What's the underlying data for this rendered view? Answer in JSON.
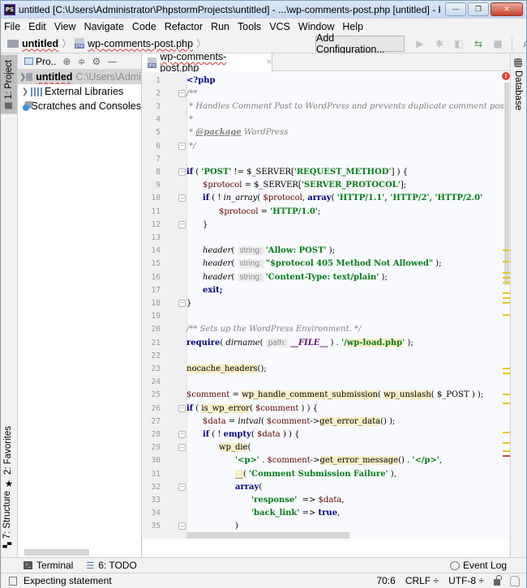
{
  "window": {
    "title": "untitled [C:\\Users\\Administrator\\PhpstormProjects\\untitled] - ...\\wp-comments-post.php [untitled] - PhpSto...",
    "app_logo": "PS",
    "buttons": {
      "minimize": "—",
      "maximize": "❐",
      "close": "✕"
    }
  },
  "menu": [
    "File",
    "Edit",
    "View",
    "Navigate",
    "Code",
    "Refactor",
    "Run",
    "Tools",
    "VCS",
    "Window",
    "Help"
  ],
  "navbar": {
    "breadcrumbs": [
      "untitled",
      "wp-comments-post.php"
    ],
    "add_configuration": "Add Configuration...",
    "toolbar_icons": [
      "run-icon",
      "debug-icon",
      "coverage-icon",
      "attach-icon",
      "stop-icon",
      "search-icon"
    ]
  },
  "left_stripe": {
    "project_tab": "1: Project",
    "favorites_tab": "2: Favorites",
    "structure_tab": "7: Structure"
  },
  "project_panel": {
    "title": "Pro..",
    "tree": [
      {
        "label": "untitled",
        "path": "C:\\Users\\Admi",
        "expandable": true,
        "selected": true
      },
      {
        "label": "External Libraries",
        "expandable": true
      },
      {
        "label": "Scratches and Consoles",
        "expandable": false
      }
    ]
  },
  "editor": {
    "tab": {
      "label": "wp-comments-post.php",
      "close": "×"
    },
    "lines": [
      {
        "n": "1"
      },
      {
        "n": "2"
      },
      {
        "n": "3"
      },
      {
        "n": "4"
      },
      {
        "n": "5"
      },
      {
        "n": "6"
      },
      {
        "n": "7"
      },
      {
        "n": "8"
      },
      {
        "n": "9"
      },
      {
        "n": "10"
      },
      {
        "n": "11"
      },
      {
        "n": "12"
      },
      {
        "n": "13"
      },
      {
        "n": "14"
      },
      {
        "n": "15"
      },
      {
        "n": "16"
      },
      {
        "n": "17"
      },
      {
        "n": "18"
      },
      {
        "n": "19"
      },
      {
        "n": "20"
      },
      {
        "n": "21"
      },
      {
        "n": "22"
      },
      {
        "n": "23"
      },
      {
        "n": "24"
      },
      {
        "n": "25"
      },
      {
        "n": "26"
      },
      {
        "n": "27"
      },
      {
        "n": "28"
      },
      {
        "n": "29"
      },
      {
        "n": "30"
      },
      {
        "n": "31"
      },
      {
        "n": "32"
      },
      {
        "n": "33"
      },
      {
        "n": "34"
      },
      {
        "n": "35"
      }
    ],
    "code": {
      "l1": "<?php",
      "l2": "/**",
      "l3": " * Handles Comment Post to WordPress and prevents duplicate comment posting.",
      "l4": " *",
      "l5_pre": " * ",
      "l5_tag": "@package",
      "l5_post": " WordPress",
      "l6": " */",
      "l8_kw": "if",
      "l8_a": " ( ",
      "l8_s1": "'POST'",
      "l8_b": " != $_SERVER[",
      "l8_s2": "'REQUEST_METHOD'",
      "l8_c": "] ) {",
      "l9_var": "$protocol",
      "l9_a": " = $_SERVER[",
      "l9_s": "'SERVER_PROTOCOL'",
      "l9_b": "];",
      "l10_kw": "if",
      "l10_a": " ( ! ",
      "l10_fn": "in_array",
      "l10_b": "( ",
      "l10_var": "$protocol",
      "l10_c": ", ",
      "l10_kw2": "array",
      "l10_d": "( ",
      "l10_s": "'HTTP/1.1', 'HTTP/2', 'HTTP/2.0'",
      "l11_var": "$protocol",
      "l11_a": " = ",
      "l11_s": "'HTTP/1.0'",
      "l11_b": ";",
      "l12": "}",
      "l14_fn": "header",
      "l14_a": "( ",
      "l14_hint": "string:",
      "l14_s": "'Allow: POST'",
      "l14_b": " );",
      "l15_fn": "header",
      "l15_a": "( ",
      "l15_hint": "string:",
      "l15_s": "\"$protocol 405 Method Not Allowed\"",
      "l15_b": " );",
      "l16_fn": "header",
      "l16_a": "( ",
      "l16_hint": "string:",
      "l16_s": "'Content-Type: text/plain'",
      "l16_b": " );",
      "l17": "exit;",
      "l18": "}",
      "l20": "/** Sets up the WordPress Environment. */",
      "l21_kw": "require",
      "l21_a": "( ",
      "l21_fn": "dirname",
      "l21_b": "( ",
      "l21_hint": "path:",
      "l21_const": "__FILE__",
      "l21_c": " ) . ",
      "l21_s1": "'/",
      "l21_s2": "wp-load.php",
      "l21_s3": "'",
      "l21_d": " );",
      "l23_fn": "nocache_headers",
      "l23_a": "();",
      "l25_var": "$comment",
      "l25_a": " = ",
      "l25_fn1": "wp_handle_comment_submission",
      "l25_b": "( ",
      "l25_fn2": "wp_unslash",
      "l25_c": "( $_POST ) );",
      "l26_kw": "if",
      "l26_a": " ( ",
      "l26_fn": "is_wp_error",
      "l26_b": "( ",
      "l26_var": "$comment",
      "l26_c": " ) ) {",
      "l27_var": "$data",
      "l27_a": " = ",
      "l27_fn": "intval",
      "l27_b": "( ",
      "l27_var2": "$comment",
      "l27_c": "->",
      "l27_m": "get_error_data",
      "l27_d": "() );",
      "l28_kw": "if",
      "l28_a": " ( ! ",
      "l28_kw2": "empty",
      "l28_b": "( ",
      "l28_var": "$data",
      "l28_c": " ) ) {",
      "l29_fn": "wp_die",
      "l29_a": "(",
      "l30_s1": "'<p>'",
      "l30_a": " . ",
      "l30_var": "$comment",
      "l30_b": "->",
      "l30_m": "get_error_message",
      "l30_c": "() . ",
      "l30_s2": "'</p>'",
      "l30_d": ",",
      "l31_fn": "__",
      "l31_a": "( ",
      "l31_s": "'Comment Submission Failure'",
      "l31_b": " ),",
      "l32_kw": "array",
      "l32_a": "(",
      "l33_s": "'response'",
      "l33_a": "  => ",
      "l33_var": "$data",
      "l33_b": ",",
      "l34_s": "'back_link'",
      "l34_a": " => ",
      "l34_kw": "true",
      "l34_b": ",",
      "l35": ")"
    },
    "error_indicator": "!"
  },
  "right_stripe": {
    "database_tab": "Database"
  },
  "bottom_tools": {
    "terminal": "Terminal",
    "todo": "6: TODO",
    "event_log": "Event Log"
  },
  "status": {
    "message": "Expecting statement",
    "position": "70:6",
    "line_separator": "CRLF ÷",
    "encoding": "UTF-8 ÷"
  }
}
